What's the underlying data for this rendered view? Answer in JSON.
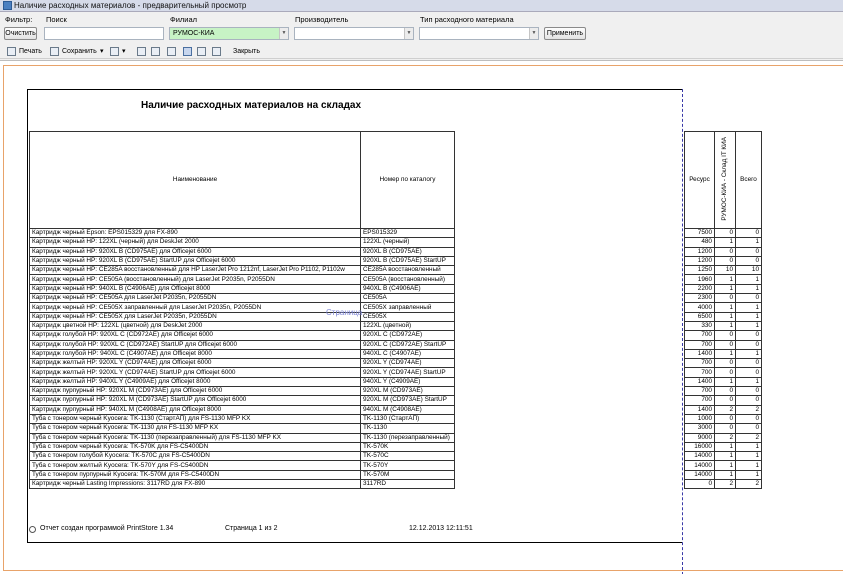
{
  "window": {
    "title": "Наличие расходных материалов - предварительный просмотр"
  },
  "filters": {
    "filter_label": "Фильтр:",
    "search_label": "Поиск",
    "clear_button": "Очистить",
    "branch_label": "Филиал",
    "branch_value": "РУМОС-КИА",
    "manufacturer_label": "Производитель",
    "manufacturer_value": "",
    "type_label": "Тип расходного материала",
    "type_value": "",
    "apply_button": "Применить",
    "branch_color": "#c7f3c5"
  },
  "toolbar": {
    "print_label": "Печать",
    "save_label": "Сохранить",
    "close_label": "Закрыть"
  },
  "report": {
    "title": "Наличие расходных материалов на складах",
    "col_name": "Наименование",
    "col_catalog": "Номер по каталогу",
    "col_resource": "Ресурс",
    "col_stock": "РУМОС-КИА - Склад IT КИА",
    "col_total": "Всего",
    "watermark": "Страница",
    "footer_program": "Отчет создан программой PrintStore 1.34",
    "footer_page": "Страница 1 из 2",
    "footer_date": "12.12.2013 12:11:51",
    "rows": [
      {
        "name": "Картридж черный Epson: EPS015329 для FX-890",
        "cat": "EPS015329",
        "res": "7500",
        "stock": "0",
        "total": "0"
      },
      {
        "name": "Картридж черный HP: 122XL (черный) для DeskJet 2000",
        "cat": "122XL (черный)",
        "res": "480",
        "stock": "1",
        "total": "1"
      },
      {
        "name": "Картридж черный HP: 920XL B (CD975AE) для Officejet 6000",
        "cat": "920XL B (CD975AE)",
        "res": "1200",
        "stock": "0",
        "total": "0"
      },
      {
        "name": "Картридж черный HP: 920XL B (CD975AE) StartUP для Officejet 6000",
        "cat": "920XL B (CD975AE) StartUP",
        "res": "1200",
        "stock": "0",
        "total": "0"
      },
      {
        "name": "Картридж черный HP: CE285A восстановленный для HP LaserJet Pro 1212nf, LaserJet Pro P1102, P1102w",
        "cat": "CE285A восстановленный",
        "res": "1250",
        "stock": "10",
        "total": "10"
      },
      {
        "name": "Картридж черный HP: CE505A (восстановленный) для LaserJet P2035n, P2055DN",
        "cat": "CE505A (восстановленный)",
        "res": "1960",
        "stock": "1",
        "total": "1"
      },
      {
        "name": "Картридж черный HP: 940XL B (C4906AE) для Officejet 8000",
        "cat": "940XL B (C4906AE)",
        "res": "2200",
        "stock": "1",
        "total": "1"
      },
      {
        "name": "Картридж черный HP: CE505A для LaserJet P2035n, P2055DN",
        "cat": "CE505A",
        "res": "2300",
        "stock": "0",
        "total": "0"
      },
      {
        "name": "Картридж черный HP: CE505X заправленный для LaserJet P2035n, P2055DN",
        "cat": "CE505X заправленный",
        "res": "4000",
        "stock": "1",
        "total": "1"
      },
      {
        "name": "Картридж черный HP: CE505X для LaserJet P2035n, P2055DN",
        "cat": "CE505X",
        "res": "6500",
        "stock": "1",
        "total": "1"
      },
      {
        "name": "Картридж цветной HP: 122XL (цветной) для DeskJet 2000",
        "cat": "122XL (цветной)",
        "res": "330",
        "stock": "1",
        "total": "1"
      },
      {
        "name": "Картридж голубой HP: 920XL C (CD972AE) для Officejet 6000",
        "cat": "920XL C (CD972AE)",
        "res": "700",
        "stock": "0",
        "total": "0"
      },
      {
        "name": "Картридж голубой HP: 920XL C (CD972AE) StartUP для Officejet 6000",
        "cat": "920XL C (CD972AE) StartUP",
        "res": "700",
        "stock": "0",
        "total": "0"
      },
      {
        "name": "Картридж голубой HP: 940XL C (C4907AE) для Officejet 8000",
        "cat": "940XL C (C4907AE)",
        "res": "1400",
        "stock": "1",
        "total": "1"
      },
      {
        "name": "Картридж желтый HP: 920XL Y (CD974AE) для Officejet 6000",
        "cat": "920XL Y (CD974AE)",
        "res": "700",
        "stock": "0",
        "total": "0"
      },
      {
        "name": "Картридж желтый HP: 920XL Y (CD974AE) StartUP для Officejet 6000",
        "cat": "920XL Y (CD974AE) StartUP",
        "res": "700",
        "stock": "0",
        "total": "0"
      },
      {
        "name": "Картридж желтый HP: 940XL Y (C4909AE) для Officejet 8000",
        "cat": "940XL Y (C4909AE)",
        "res": "1400",
        "stock": "1",
        "total": "1"
      },
      {
        "name": "Картридж пурпурный HP: 920XL M (CD973AE) для Officejet 6000",
        "cat": "920XL M (CD973AE)",
        "res": "700",
        "stock": "0",
        "total": "0"
      },
      {
        "name": "Картридж пурпурный HP: 920XL M (CD973AE) StartUP для Officejet 6000",
        "cat": "920XL M (CD973AE) StartUP",
        "res": "700",
        "stock": "0",
        "total": "0"
      },
      {
        "name": "Картридж пурпурный HP: 940XL M (C4908AE) для Officejet 8000",
        "cat": "940XL M (C4908AE)",
        "res": "1400",
        "stock": "2",
        "total": "2"
      },
      {
        "name": "Туба с тонером черный Kyocera: TK-1130 (СтартАП) для FS-1130 MFP KX",
        "cat": "TK-1130 (СтартАП)",
        "res": "1000",
        "stock": "0",
        "total": "0"
      },
      {
        "name": "Туба с тонером черный Kyocera: TK-1130 для FS-1130 MFP KX",
        "cat": "TK-1130",
        "res": "3000",
        "stock": "0",
        "total": "0"
      },
      {
        "name": "Туба с тонером черный Kyocera: TK-1130 (перезаправленный) для FS-1130 MFP KX",
        "cat": "TK-1130 (перезаправленный)",
        "res": "9000",
        "stock": "2",
        "total": "2"
      },
      {
        "name": "Туба с тонером черный Kyocera: TK-570K для FS-C5400DN",
        "cat": "TK-570K",
        "res": "16000",
        "stock": "1",
        "total": "1"
      },
      {
        "name": "Туба с тонером голубой Kyocera: TK-570C для FS-C5400DN",
        "cat": "TK-570C",
        "res": "14000",
        "stock": "1",
        "total": "1"
      },
      {
        "name": "Туба с тонером желтый Kyocera: TK-570Y для FS-C5400DN",
        "cat": "TK-570Y",
        "res": "14000",
        "stock": "1",
        "total": "1"
      },
      {
        "name": "Туба с тонером пурпурный Kyocera: TK-570M для FS-C5400DN",
        "cat": "TK-570M",
        "res": "14000",
        "stock": "1",
        "total": "1"
      },
      {
        "name": "Картридж черный Lasting Impressions: 3117RD для FX-890",
        "cat": "3117RD",
        "res": "0",
        "stock": "2",
        "total": "2"
      }
    ]
  }
}
